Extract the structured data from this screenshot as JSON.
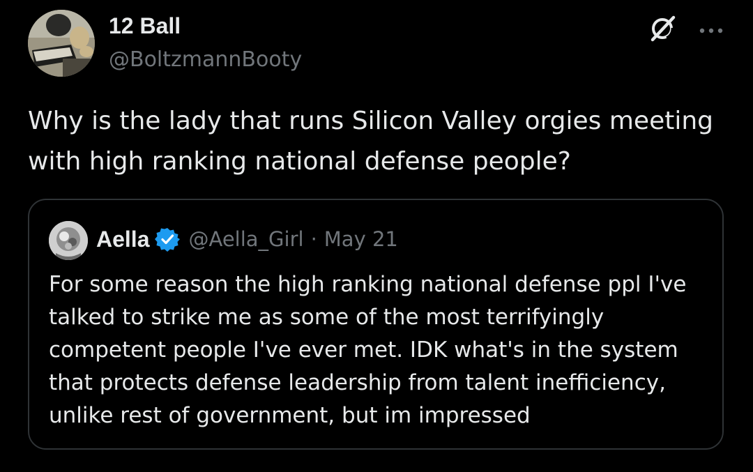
{
  "tweet": {
    "author": {
      "name": "12 Ball",
      "handle": "@BoltzmannBooty",
      "avatar_icon": "avatar-photo"
    },
    "actions": {
      "grok_icon": "grok-icon",
      "more_icon": "more-options-icon"
    },
    "text": "Why is the lady that runs Silicon Valley orgies meeting with high ranking national defense people?",
    "quote": {
      "author": {
        "name": "Aella",
        "verified": true,
        "verified_icon": "verified-badge-icon",
        "handle": "@Aella_Girl",
        "separator": "·",
        "date": "May 21"
      },
      "text": "For some reason the high ranking national defense ppl I've talked to strike me as some of the most terrifyingly competent people I've ever met. IDK what's in the system that protects defense leadership from talent inefficiency, unlike rest of government, but im impressed"
    }
  },
  "colors": {
    "background": "#000000",
    "primary_text": "#e7e9ea",
    "secondary_text": "#71767b",
    "border": "#2f3336",
    "verified_blue": "#1d9bf0"
  }
}
